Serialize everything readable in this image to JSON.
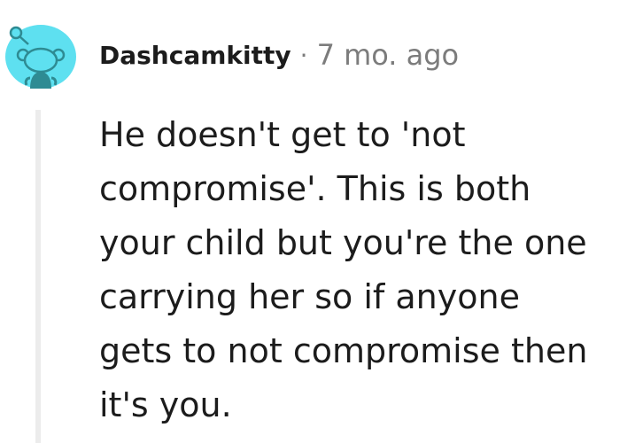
{
  "comment": {
    "author": "Dashcamkitty",
    "separator": "·",
    "timestamp": "7 mo. ago",
    "body_lines": [
      "He doesn't get to 'not",
      "compromise'. This is both",
      "your child but you're the one",
      "carrying her so if anyone",
      "gets to not compromise then",
      "it's you."
    ],
    "avatar": {
      "icon": "reddit-snoo-avatar-icon",
      "background_color": "#5ee0f0",
      "figure_color": "#2e8b93"
    }
  }
}
